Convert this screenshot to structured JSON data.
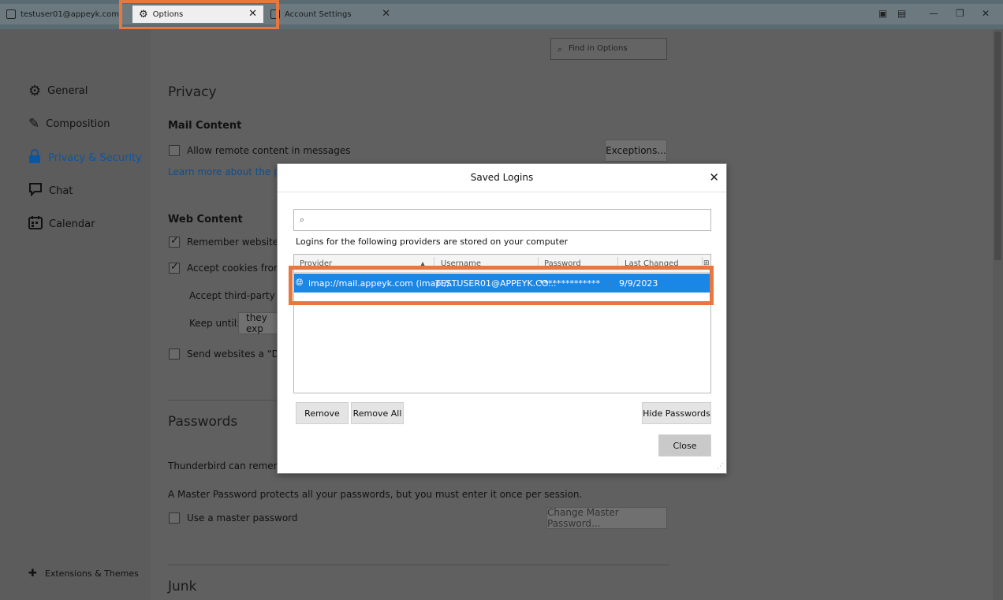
{
  "window": {
    "tabs": [
      {
        "label": "testuser01@appeyk.com"
      },
      {
        "label": "Options"
      },
      {
        "label": "Account Settings"
      }
    ]
  },
  "sidebar": {
    "items": [
      {
        "label": "General",
        "icon": "gear-icon"
      },
      {
        "label": "Composition",
        "icon": "pencil-icon"
      },
      {
        "label": "Privacy & Security",
        "icon": "lock-icon",
        "active": true
      },
      {
        "label": "Chat",
        "icon": "chat-icon"
      },
      {
        "label": "Calendar",
        "icon": "calendar-icon"
      }
    ],
    "footer": "Extensions & Themes"
  },
  "search": {
    "placeholder": "Find in Options"
  },
  "privacy": {
    "title": "Privacy",
    "mail_content": "Mail Content",
    "allow_remote": "Allow remote content in messages",
    "exceptions": "Exceptions...",
    "learn_more": "Learn more about the priv"
  },
  "web_content": {
    "title": "Web Content",
    "remember": "Remember websites a",
    "accept_cookies": "Accept cookies from s",
    "third_party": "Accept third-party co",
    "keep_until": "Keep until:",
    "keep_value": "they exp",
    "dnt": "Send websites a “Do N"
  },
  "passwords": {
    "title": "Passwords",
    "remember": "Thunderbird can remember",
    "master_desc": "A Master Password protects all your passwords, but you must enter it once per session.",
    "use_master": "Use a master password",
    "change_master": "Change Master Password..."
  },
  "junk": {
    "title": "Junk"
  },
  "dialog": {
    "title": "Saved Logins",
    "intro": "Logins for the following providers are stored on your computer",
    "columns": [
      "Provider",
      "Username",
      "Password",
      "Last Changed"
    ],
    "row": {
      "provider": "imap://mail.appeyk.com (imap://...",
      "username": "TESTUSER01@APPEYK.CO...",
      "password": "**************",
      "last_changed": "9/9/2023"
    },
    "remove": "Remove",
    "remove_all": "Remove All",
    "hide_passwords": "Hide Passwords",
    "close": "Close"
  },
  "colors": {
    "highlight": "#e8773f",
    "selection": "#1a86e6",
    "link": "#0b4f94"
  }
}
